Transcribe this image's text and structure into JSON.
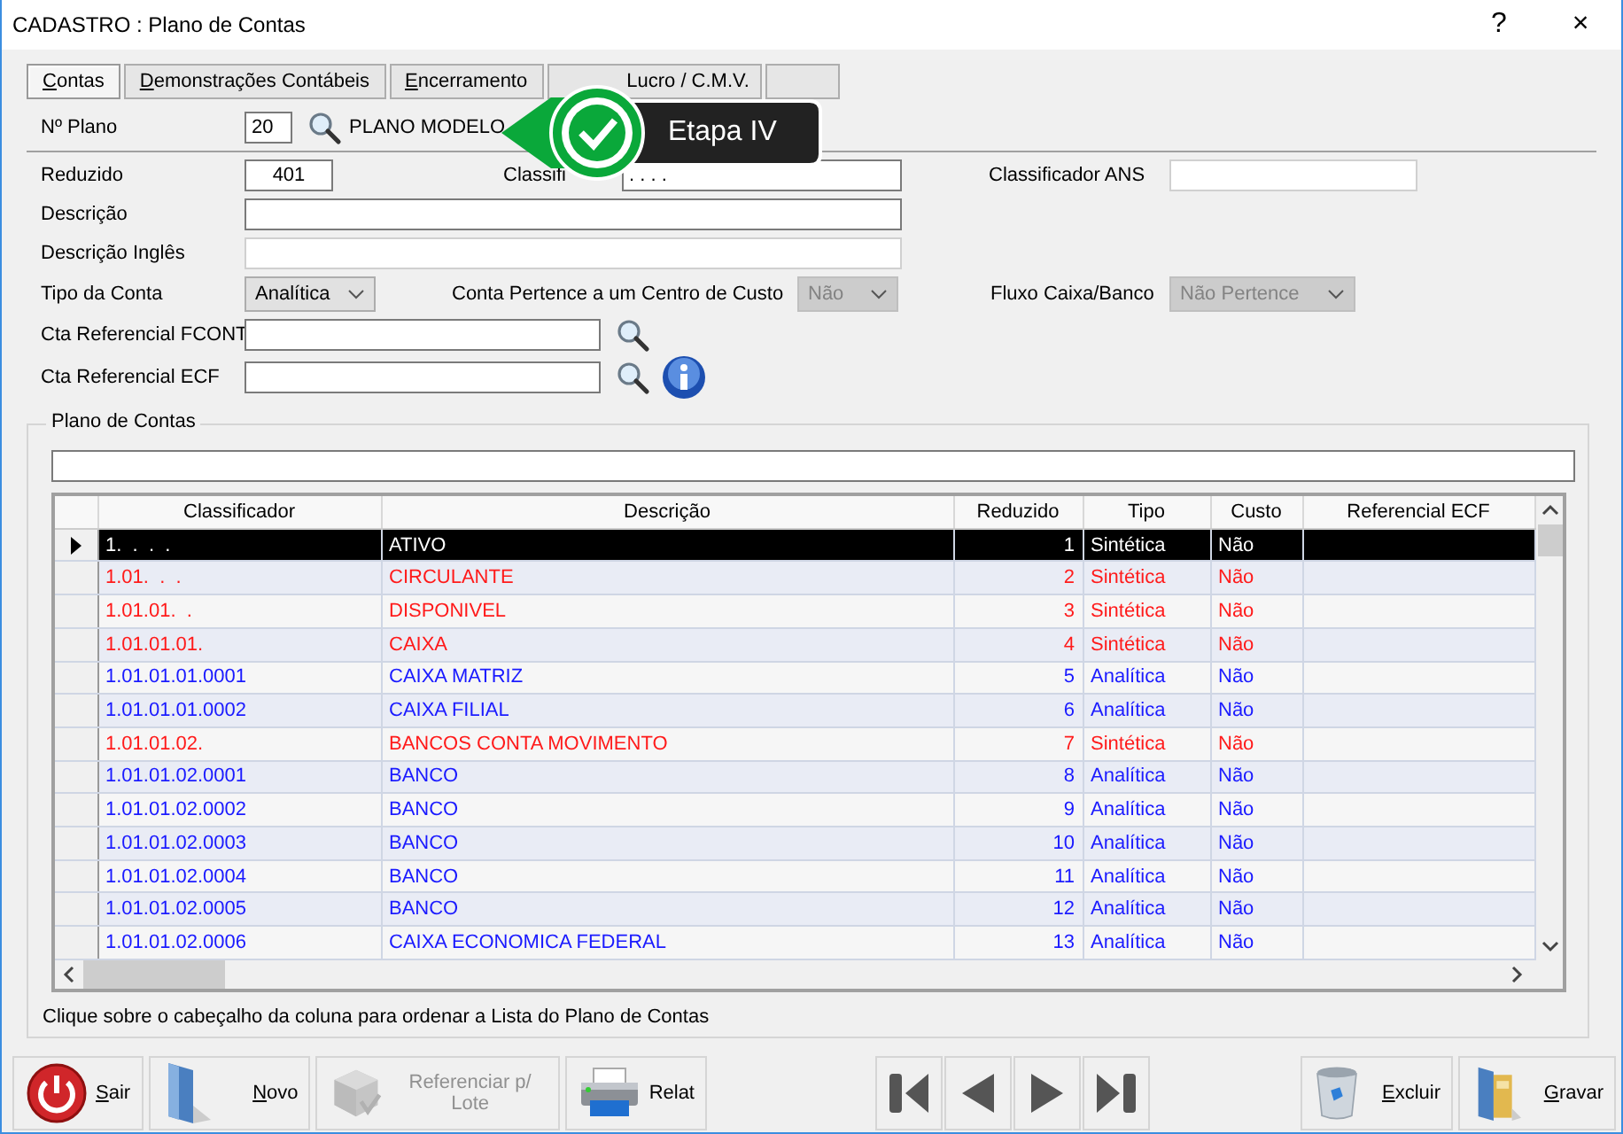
{
  "window": {
    "title": "CADASTRO : Plano de Contas",
    "help": "?",
    "close": "×"
  },
  "tabs": [
    {
      "label": "Contas",
      "selected": true
    },
    {
      "label": "Demonstrações Contábeis",
      "selected": false
    },
    {
      "label": "Encerramento",
      "selected": false
    },
    {
      "label": "Lucro / C.M.V.",
      "selected": false
    },
    {
      "selected": false
    }
  ],
  "callout": {
    "label": "Etapa IV"
  },
  "plano": {
    "label": "Nº Plano",
    "value": "20",
    "name": "PLANO MODELO"
  },
  "form": {
    "reduzido": {
      "label": "Reduzido",
      "value": "401"
    },
    "classificador": {
      "label": "Classifi",
      "value": ". . . ."
    },
    "classificador_ans": {
      "label": "Classificador ANS"
    },
    "descricao": {
      "label": "Descrição"
    },
    "descricao_ingles": {
      "label": "Descrição Inglês"
    },
    "tipo": {
      "label": "Tipo da Conta",
      "value": "Analítica",
      "disabled": false
    },
    "centro_custo": {
      "label": "Conta Pertence a um Centro de Custo",
      "value": "Não",
      "disabled": true
    },
    "fluxo": {
      "label": "Fluxo Caixa/Banco",
      "value": "Não Pertence",
      "disabled": true
    },
    "fcont": {
      "label": "Cta Referencial FCONT"
    },
    "ecf": {
      "label": "Cta Referencial ECF"
    }
  },
  "group": {
    "title": "Plano de Contas",
    "hint": "Clique sobre o cabeçalho da coluna para ordenar a Lista do Plano de Contas"
  },
  "table": {
    "columns": [
      "Classificador",
      "Descrição",
      "Reduzido",
      "Tipo",
      "Custo",
      "Referencial ECF"
    ],
    "rows": [
      {
        "classificador": "1.  .  .  .",
        "descricao": "ATIVO",
        "reduzido": "1",
        "tipo": "Sintética",
        "custo": "Não",
        "kind": "sintetica",
        "selected": true
      },
      {
        "classificador": "1.01.  .  .",
        "descricao": "CIRCULANTE",
        "reduzido": "2",
        "tipo": "Sintética",
        "custo": "Não",
        "kind": "sintetica",
        "selected": false
      },
      {
        "classificador": "1.01.01.  .",
        "descricao": "DISPONIVEL",
        "reduzido": "3",
        "tipo": "Sintética",
        "custo": "Não",
        "kind": "sintetica",
        "selected": false
      },
      {
        "classificador": "1.01.01.01.",
        "descricao": "CAIXA",
        "reduzido": "4",
        "tipo": "Sintética",
        "custo": "Não",
        "kind": "sintetica",
        "selected": false
      },
      {
        "classificador": "1.01.01.01.0001",
        "descricao": "CAIXA MATRIZ",
        "reduzido": "5",
        "tipo": "Analítica",
        "custo": "Não",
        "kind": "analitica",
        "selected": false
      },
      {
        "classificador": "1.01.01.01.0002",
        "descricao": "CAIXA FILIAL",
        "reduzido": "6",
        "tipo": "Analítica",
        "custo": "Não",
        "kind": "analitica",
        "selected": false
      },
      {
        "classificador": "1.01.01.02.",
        "descricao": "BANCOS CONTA MOVIMENTO",
        "reduzido": "7",
        "tipo": "Sintética",
        "custo": "Não",
        "kind": "sintetica",
        "selected": false
      },
      {
        "classificador": "1.01.01.02.0001",
        "descricao": "BANCO",
        "reduzido": "8",
        "tipo": "Analítica",
        "custo": "Não",
        "kind": "analitica",
        "selected": false
      },
      {
        "classificador": "1.01.01.02.0002",
        "descricao": "BANCO",
        "reduzido": "9",
        "tipo": "Analítica",
        "custo": "Não",
        "kind": "analitica",
        "selected": false
      },
      {
        "classificador": "1.01.01.02.0003",
        "descricao": "BANCO",
        "reduzido": "10",
        "tipo": "Analítica",
        "custo": "Não",
        "kind": "analitica",
        "selected": false
      },
      {
        "classificador": "1.01.01.02.0004",
        "descricao": "BANCO",
        "reduzido": "11",
        "tipo": "Analítica",
        "custo": "Não",
        "kind": "analitica",
        "selected": false
      },
      {
        "classificador": "1.01.01.02.0005",
        "descricao": "BANCO",
        "reduzido": "12",
        "tipo": "Analítica",
        "custo": "Não",
        "kind": "analitica",
        "selected": false
      },
      {
        "classificador": "1.01.01.02.0006",
        "descricao": "CAIXA ECONOMICA FEDERAL",
        "reduzido": "13",
        "tipo": "Analítica",
        "custo": "Não",
        "kind": "analitica",
        "selected": false
      }
    ]
  },
  "buttons": [
    {
      "label": "Sair",
      "kind": "power",
      "disabled": false
    },
    {
      "label": "Novo",
      "kind": "folder",
      "disabled": false
    },
    {
      "label": "Referenciar p/ Lote",
      "kind": "cube",
      "disabled": true
    },
    {
      "label": "Relat",
      "kind": "printer",
      "disabled": false
    }
  ],
  "navigation": [
    {
      "kind": "first"
    },
    {
      "kind": "previous"
    },
    {
      "kind": "next"
    },
    {
      "kind": "last"
    }
  ],
  "actions": [
    {
      "label": "Excluir",
      "kind": "trash",
      "disabled": false
    },
    {
      "label": "Gravar",
      "kind": "binder",
      "disabled": false
    }
  ]
}
